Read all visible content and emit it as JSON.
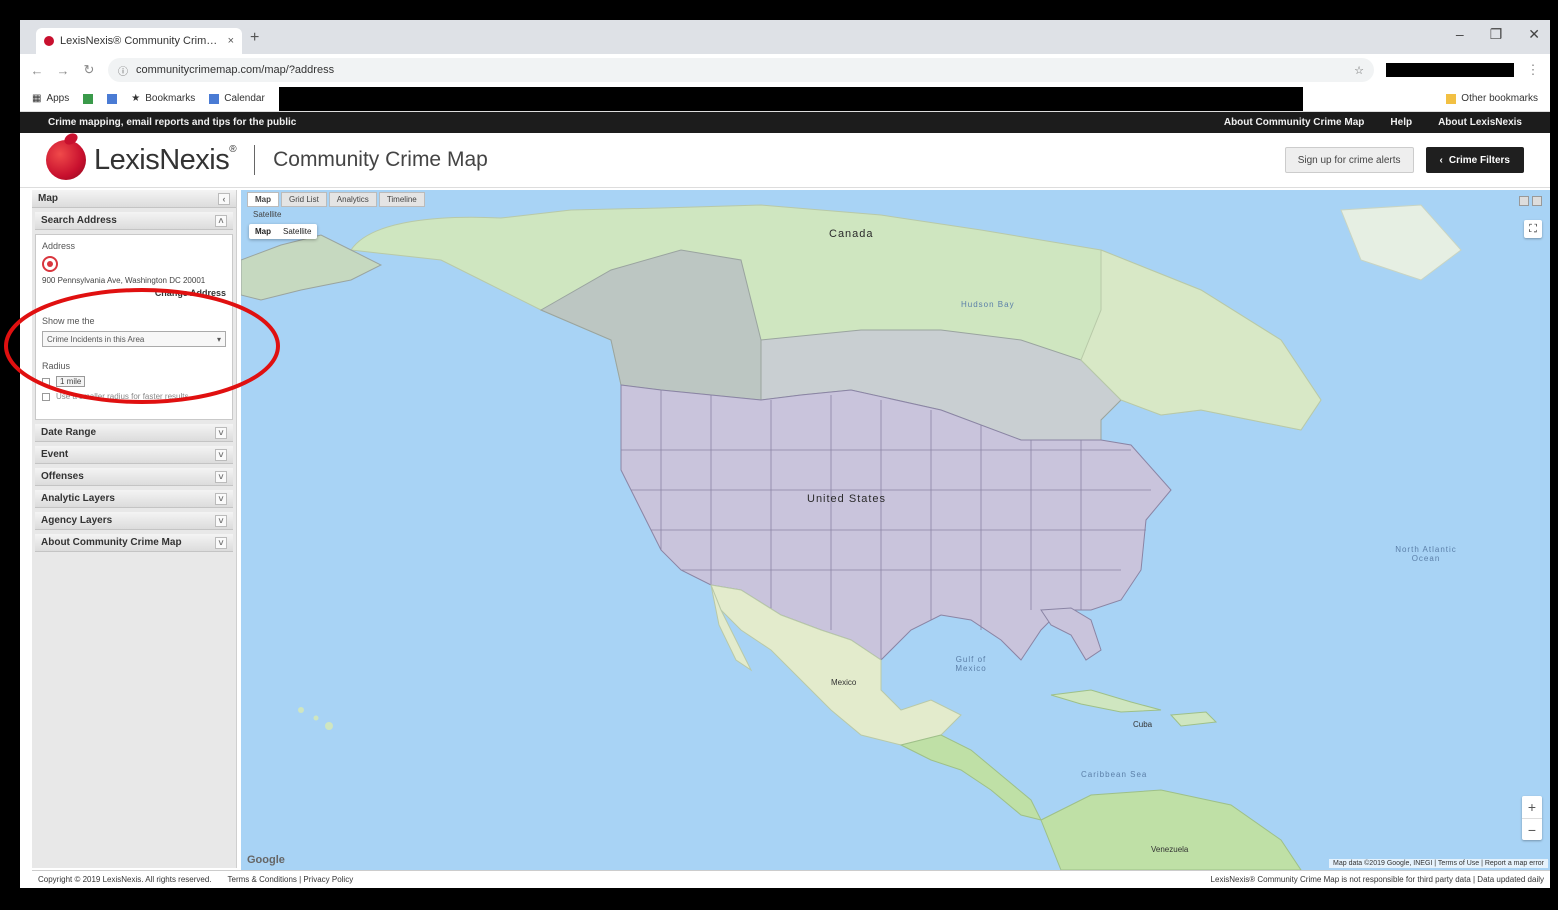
{
  "browser": {
    "tab_title": "LexisNexis® Community Crime Map",
    "tab_close": "×",
    "new_tab": "+",
    "window_controls": [
      "–",
      "❐",
      "✕"
    ],
    "url": "communitycrimemap.com/map/?address",
    "bookmarks": [
      "Apps",
      "",
      "",
      "Bookmarks",
      "Calendar"
    ],
    "other_bookmarks": "Other bookmarks"
  },
  "site": {
    "tagline": "Crime mapping, email reports and tips for the public",
    "top_links": [
      "About Community Crime Map",
      "Help",
      "About LexisNexis"
    ],
    "brand": "LexisNexis",
    "brand_mark": "®",
    "product": "Community Crime Map",
    "btn_sign_up": "Sign up for crime alerts",
    "btn_filters": "Crime Filters"
  },
  "panel": {
    "header": "Map",
    "search_section": "Search Address",
    "address_label": "Address",
    "address_value": "900 Pennsylvania Ave, Washington DC 20001",
    "change_link": "Change Address",
    "show_label": "Show me the",
    "show_value": "Crime Incidents in this Area",
    "radius_label": "Radius",
    "radius_value": "1 mile",
    "radius_note": "Use a smaller radius for faster results",
    "sections": [
      "Date Range",
      "Event",
      "Offenses",
      "Analytic Layers",
      "Agency Layers",
      "About Community Crime Map"
    ]
  },
  "map": {
    "tabs": [
      "Map",
      "Grid List",
      "Analytics",
      "Timeline"
    ],
    "tile_caption": "Satellite",
    "map_type": [
      "Map",
      "Satellite"
    ],
    "labels": {
      "canada": "Canada",
      "us": "United States",
      "mexico": "Mexico",
      "cuba": "Cuba",
      "venezuela": "Venezuela",
      "atlantic": "North Atlantic Ocean",
      "gulf": "Gulf of Mexico",
      "caribbean": "Caribbean Sea",
      "hudson": "Hudson Bay"
    },
    "zoom_in": "+",
    "zoom_out": "−",
    "fullscreen": "⛶",
    "google": "Google",
    "attribution": "Map data ©2019 Google, INEGI | Terms of Use | Report a map error"
  },
  "footer": {
    "copyright": "Copyright © 2019 LexisNexis. All rights reserved.",
    "links": "Terms & Conditions | Privacy Policy",
    "right": "LexisNexis® Community Crime Map is not responsible for third party data | Data updated daily"
  },
  "colors": {
    "brand_red": "#c8102e",
    "annotation_red": "#e01010",
    "water": "#a8d3f5",
    "us_fill": "#c9c4dc"
  }
}
